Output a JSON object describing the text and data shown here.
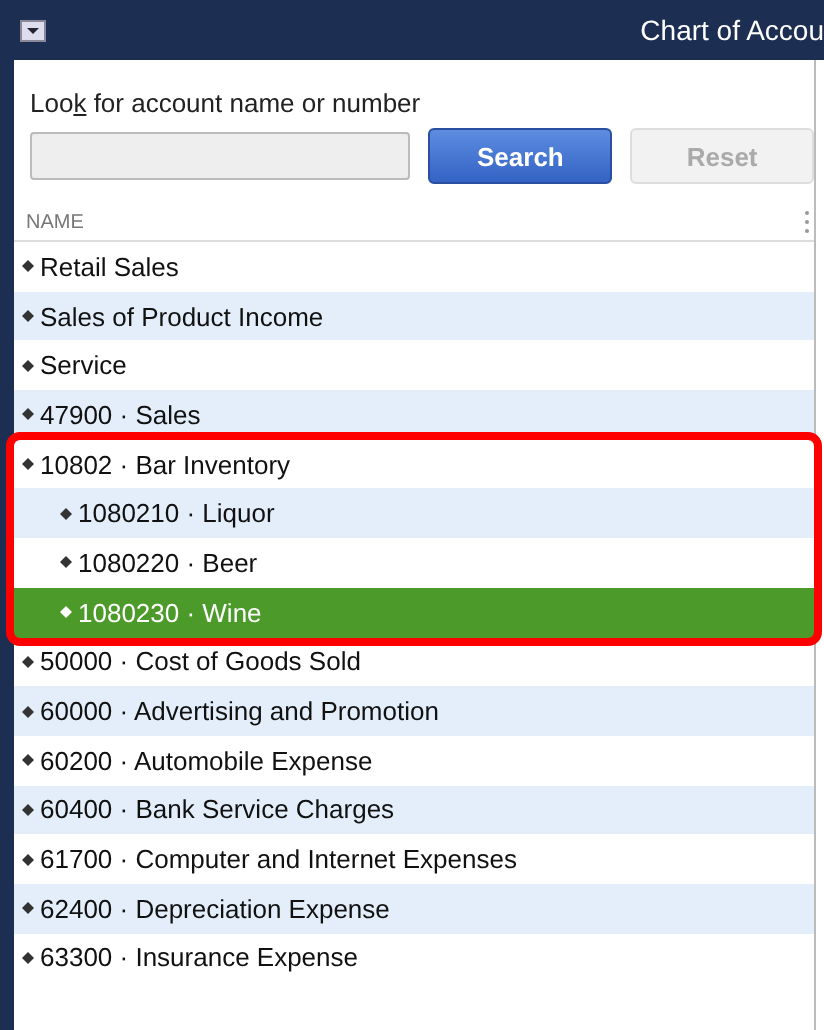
{
  "window": {
    "title": "Chart of Accou"
  },
  "search": {
    "label_before": "Loo",
    "label_access_key": "k",
    "label_after": " for account name or number",
    "button": "Search",
    "reset": "Reset",
    "reset_disabled": true
  },
  "table": {
    "columns": [
      "NAME"
    ],
    "rows": [
      {
        "name": "Retail Sales",
        "selected": false,
        "boxed": false
      },
      {
        "name": "Sales of Product Income",
        "selected": false,
        "boxed": false
      },
      {
        "name": "Service",
        "selected": false,
        "boxed": false
      },
      {
        "name": "47900 · Sales",
        "selected": false,
        "boxed": false
      },
      {
        "name": "10802 · Bar Inventory",
        "selected": false,
        "boxed": true,
        "children": [
          {
            "name": "1080210 · Liquor",
            "selected": false,
            "boxed": true
          },
          {
            "name": "1080220 · Beer",
            "selected": false,
            "boxed": true
          },
          {
            "name": "1080230 · Wine",
            "selected": true,
            "boxed": true
          }
        ]
      },
      {
        "name": "50000 · Cost of Goods Sold",
        "selected": false,
        "boxed": false
      },
      {
        "name": "60000 · Advertising and Promotion",
        "selected": false,
        "boxed": false
      },
      {
        "name": "60200 · Automobile Expense",
        "selected": false,
        "boxed": false
      },
      {
        "name": "60400 · Bank Service Charges",
        "selected": false,
        "boxed": false
      },
      {
        "name": "61700 · Computer and Internet Expenses",
        "selected": false,
        "boxed": false
      },
      {
        "name": "62400 · Depreciation Expense",
        "selected": false,
        "boxed": false
      },
      {
        "name": "63300 · Insurance Expense",
        "selected": false,
        "boxed": false
      }
    ]
  }
}
